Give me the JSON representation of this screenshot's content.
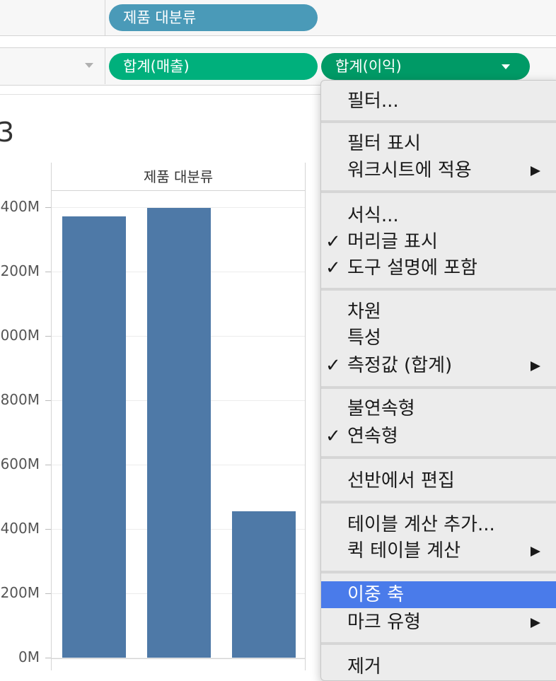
{
  "shelves": {
    "columns_pill": "제품 대분류",
    "rows_pills": [
      "합계(매출)",
      "합계(이익)"
    ]
  },
  "sheet": {
    "title_fragment": "3",
    "column_header": "제품 대분류"
  },
  "chart_data": {
    "type": "bar",
    "categories": [
      "",
      "",
      ""
    ],
    "values": [
      1371,
      1398,
      455
    ],
    "unit": "M",
    "ylim": [
      0,
      1500
    ],
    "ytick_labels": [
      "0M",
      "200M",
      "400M",
      "600M",
      "800M",
      "000M",
      "200M",
      "400M"
    ],
    "color": "#4e79a7"
  },
  "context_menu": {
    "items": {
      "filter": "필터...",
      "show_filter": "필터 표시",
      "apply_to_worksheets": "워크시트에 적용",
      "format": "서식...",
      "show_header": "머리글 표시",
      "include_in_tooltip": "도구 설명에 포함",
      "dimension": "차원",
      "attribute": "특성",
      "measure_sum": "측정값 (합계)",
      "discrete": "불연속형",
      "continuous": "연속형",
      "edit_in_shelf": "선반에서 편집",
      "add_table_calc": "테이블 계산 추가...",
      "quick_table_calc": "퀵 테이블 계산",
      "dual_axis": "이중 축",
      "mark_type": "마크 유형",
      "remove": "제거"
    },
    "checkmark": "✓",
    "highlight_color": "#4a7bea"
  }
}
